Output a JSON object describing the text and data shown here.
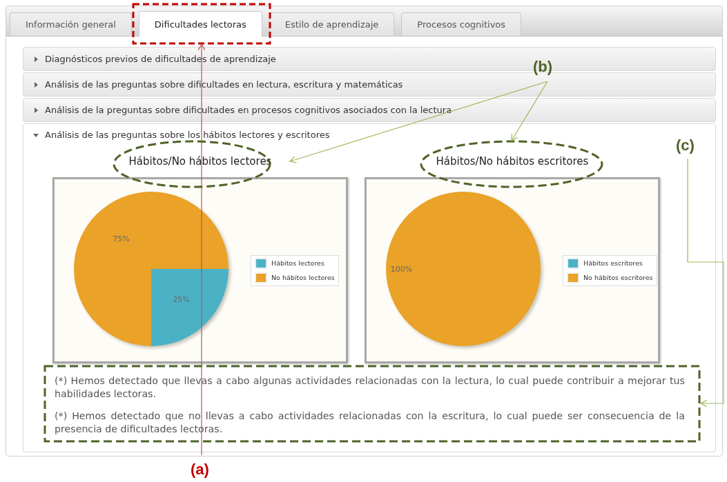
{
  "tabs": [
    {
      "label": "Información general",
      "selected": false
    },
    {
      "label": "Dificultades lectoras",
      "selected": true
    },
    {
      "label": "Estilo de aprendizaje",
      "selected": false
    },
    {
      "label": "Procesos cognitivos",
      "selected": false
    }
  ],
  "accordion": [
    {
      "title": "Diagnósticos previos de dificultades de aprendizaje",
      "expanded": false
    },
    {
      "title": "Análisis de las preguntas sobre dificultades en lectura, escritura y matemáticas",
      "expanded": false
    },
    {
      "title": "Análisis de la preguntas sobre dificultades en procesos cognitivos asociados con la lectura",
      "expanded": false
    },
    {
      "title": "Análisis de las preguntas sobre los hábitos lectores y escritores",
      "expanded": true,
      "charts": [
        {
          "title": "Hábitos/No hábitos lectores",
          "chart_data": {
            "type": "pie",
            "categories": [
              "Hábitos lectores",
              "No hábitos lectores"
            ],
            "values": [
              25,
              75
            ],
            "colors": [
              "#4bb2c5",
              "#eaa228"
            ],
            "value_labels": [
              "25%",
              "75%"
            ],
            "legend": "right"
          }
        },
        {
          "title": "Hábitos/No hábitos escritores",
          "chart_data": {
            "type": "pie",
            "categories": [
              "Hábitos escritores",
              "No hábitos escritores"
            ],
            "values": [
              0,
              100
            ],
            "colors": [
              "#4bb2c5",
              "#eaa228"
            ],
            "value_labels": [
              null,
              "100%"
            ],
            "legend": "right"
          }
        }
      ],
      "notes": [
        "(*) Hemos detectado que llevas a cabo algunas actividades relacionadas con la lectura, lo cual puede contribuir a mejorar tus habilidades lectoras.",
        "(*) Hemos detectado que no llevas a cabo actividades relacionadas con la escritura, lo cual puede ser consecuencia de la presencia de dificultades lectoras."
      ]
    }
  ],
  "annotations": [
    {
      "label": "(a)"
    },
    {
      "label": "(b)"
    },
    {
      "label": "(c)"
    }
  ]
}
